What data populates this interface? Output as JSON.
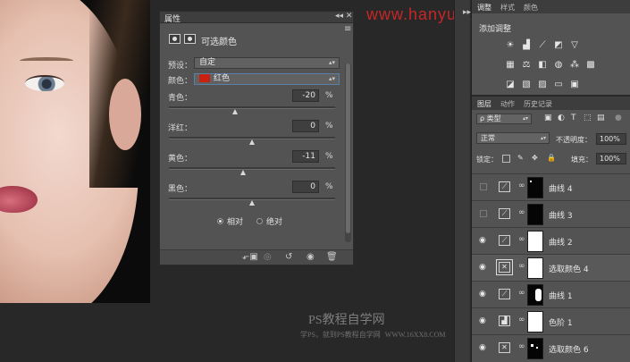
{
  "watermark_top": "www.hanyuzixue.com",
  "watermark_bottom": "PS教程自学网",
  "watermark_sub": "学PS，就到PS教程自学网",
  "watermark_url": "WWW.16XX8.COM",
  "properties": {
    "tab": "属性",
    "controls": "◂◂ ✕",
    "menu_icon": "≡",
    "title": "可选颜色",
    "preset_label": "预设：",
    "preset_value": "自定",
    "color_label": "颜色：",
    "color_value": "红色",
    "color_swatch": "#c8210f",
    "sliders": [
      {
        "label": "青色：",
        "value": "-20",
        "unit": "%",
        "num": -20
      },
      {
        "label": "洋红：",
        "value": "0",
        "unit": "%",
        "num": 0
      },
      {
        "label": "黄色：",
        "value": "-11",
        "unit": "%",
        "num": -11
      },
      {
        "label": "黑色：",
        "value": "0",
        "unit": "%",
        "num": 0
      }
    ],
    "mode_relative": "相对",
    "mode_absolute": "绝对",
    "mode_selected": "相对"
  },
  "dock": {
    "collapse_mark": "▸▸"
  },
  "adjustments": {
    "tabs": [
      "调整",
      "样式",
      "颜色"
    ],
    "title": "添加调整"
  },
  "layers": {
    "tabs": [
      "图层",
      "动作",
      "历史记录"
    ],
    "filter_label": "ρ 类型",
    "blend_mode": "正常",
    "opacity_label": "不透明度：",
    "opacity_value": "100%",
    "lock_label": "锁定：",
    "fill_label": "填充：",
    "fill_value": "100%",
    "items": [
      {
        "name": "曲线 4",
        "visible": false,
        "mask": "black"
      },
      {
        "name": "曲线 3",
        "visible": false,
        "mask": "black"
      },
      {
        "name": "曲线 2",
        "visible": true,
        "mask": "white"
      },
      {
        "name": "选取颜色 4",
        "visible": true,
        "mask": "white",
        "selected": true
      },
      {
        "name": "曲线 1",
        "visible": true,
        "mask": "black"
      },
      {
        "name": "色阶 1",
        "visible": true,
        "mask": "white"
      },
      {
        "name": "选取颜色 6",
        "visible": true,
        "mask": "black"
      }
    ]
  }
}
